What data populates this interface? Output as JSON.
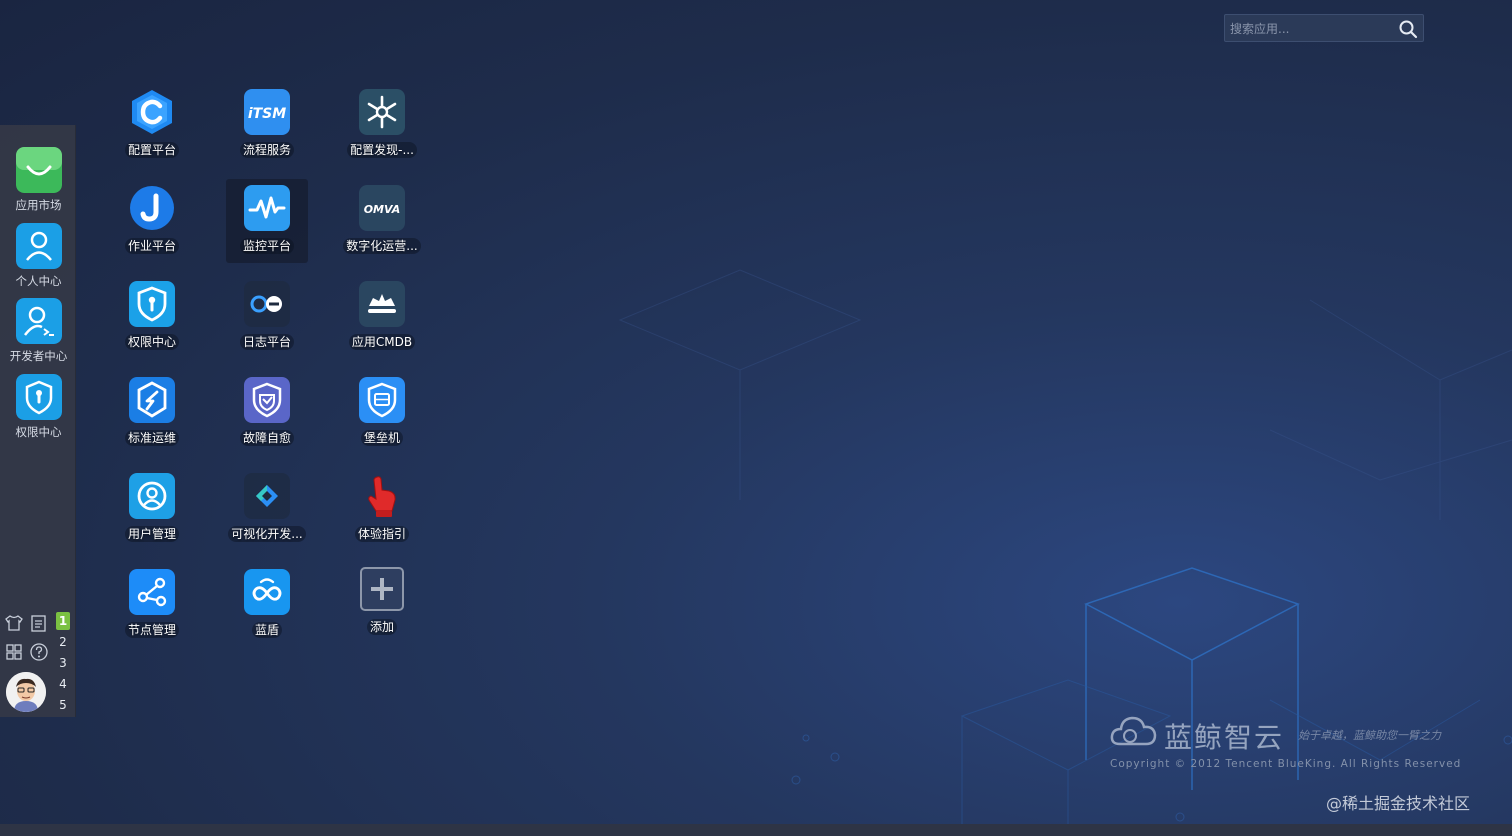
{
  "search": {
    "placeholder": "搜索应用..."
  },
  "dock": {
    "items": [
      {
        "label": "应用市场",
        "icon": "shopping-bag-icon",
        "color": "#4cc266"
      },
      {
        "label": "个人中心",
        "icon": "user-icon",
        "color": "#1ba1e8"
      },
      {
        "label": "开发者中心",
        "icon": "developer-icon",
        "color": "#1ba1e8"
      },
      {
        "label": "权限中心",
        "icon": "shield-icon",
        "color": "#1ba1e8"
      }
    ],
    "tools": [
      "theme-icon",
      "notes-icon",
      "grid-icon",
      "help-icon"
    ],
    "desktops": [
      "1",
      "2",
      "3",
      "4",
      "5"
    ],
    "active_desktop": "1"
  },
  "apps": [
    {
      "label": "配置平台",
      "icon": "cmdb-icon",
      "color": "#1d8cf8"
    },
    {
      "label": "流程服务",
      "icon": "itsm-icon",
      "color": "#2f8ff0"
    },
    {
      "label": "配置发现-...",
      "icon": "discovery-icon",
      "color": "#2b4f66"
    },
    {
      "label": "作业平台",
      "icon": "job-icon",
      "color": "#1d7be8"
    },
    {
      "label": "监控平台",
      "icon": "monitor-icon",
      "color": "#2d9cf0"
    },
    {
      "label": "数字化运营...",
      "icon": "omva-icon",
      "color": "#2a4660"
    },
    {
      "label": "权限中心",
      "icon": "iam-icon",
      "color": "#1ba1e8"
    },
    {
      "label": "日志平台",
      "icon": "log-icon",
      "color": "#1e2a3e"
    },
    {
      "label": "应用CMDB",
      "icon": "app-cmdb-icon",
      "color": "#2a4660"
    },
    {
      "label": "标准运维",
      "icon": "sops-icon",
      "color": "#1b7ee5"
    },
    {
      "label": "故障自愈",
      "icon": "fta-icon",
      "color": "#5a66c8"
    },
    {
      "label": "堡垒机",
      "icon": "bastion-icon",
      "color": "#2b8ff5"
    },
    {
      "label": "用户管理",
      "icon": "usermgr-icon",
      "color": "#1ea0e6"
    },
    {
      "label": "可视化开发...",
      "icon": "lesscode-icon",
      "color": "#1e2a3e"
    },
    {
      "label": "体验指引",
      "icon": "guide-icon",
      "color": "#d22a2a"
    },
    {
      "label": "节点管理",
      "icon": "nodeman-icon",
      "color": "#1d8cf8"
    },
    {
      "label": "蓝盾",
      "icon": "devops-icon",
      "color": "#1896f0"
    },
    {
      "label": "添加",
      "icon": "add-icon",
      "color": "#9aa4b5"
    }
  ],
  "selected_app": "监控平台",
  "brand": {
    "name": "蓝鲸智云",
    "slogan": "始于卓越，蓝鲸助您一臂之力",
    "copyright": "Copyright © 2012 Tencent BlueKing. All Rights Reserved"
  },
  "watermark": "@稀土掘金技术社区"
}
